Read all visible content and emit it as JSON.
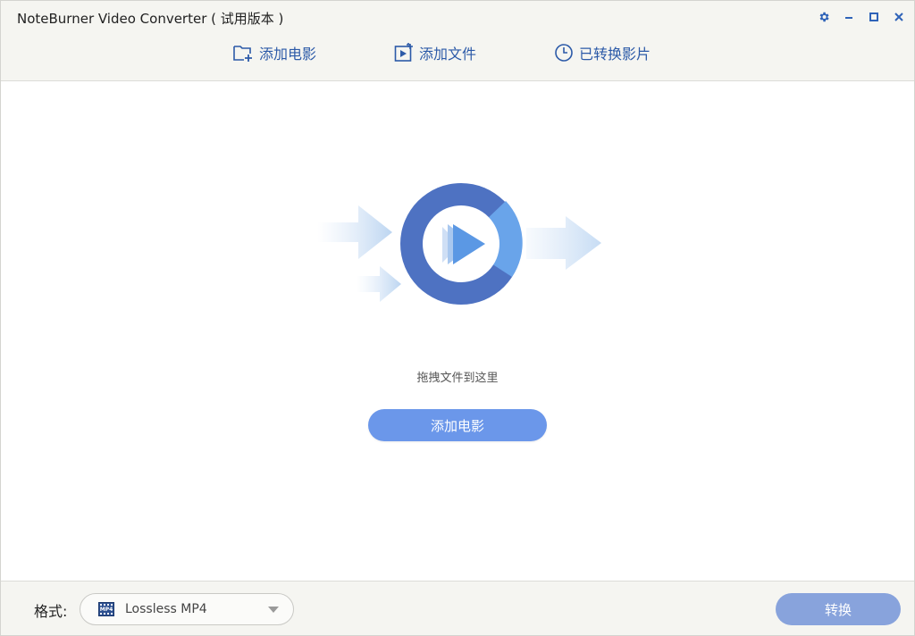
{
  "window": {
    "title": "NoteBurner Video Converter ( 试用版本 )"
  },
  "toolbar": {
    "add_movie_label": "添加电影",
    "add_file_label": "添加文件",
    "converted_label": "已转换影片"
  },
  "main": {
    "drop_text": "拖拽文件到这里",
    "add_movie_button": "添加电影"
  },
  "footer": {
    "format_label": "格式:",
    "format_value": "Lossless MP4",
    "format_icon_text": "MP4",
    "convert_button": "转换"
  },
  "colors": {
    "accent": "#2c5aa8",
    "primary_button": "#6b97ea",
    "convert_button": "#88a3dc",
    "header_bg": "#f5f5f1"
  },
  "icons": {
    "settings": "gear-icon",
    "minimize": "minimize-icon",
    "maximize": "maximize-icon",
    "close": "close-icon",
    "add_movie": "folder-plus-icon",
    "add_file": "video-file-plus-icon",
    "converted": "clock-icon",
    "hero": "play-disc-icon",
    "format": "mp4-film-icon",
    "dropdown": "chevron-down-icon"
  }
}
